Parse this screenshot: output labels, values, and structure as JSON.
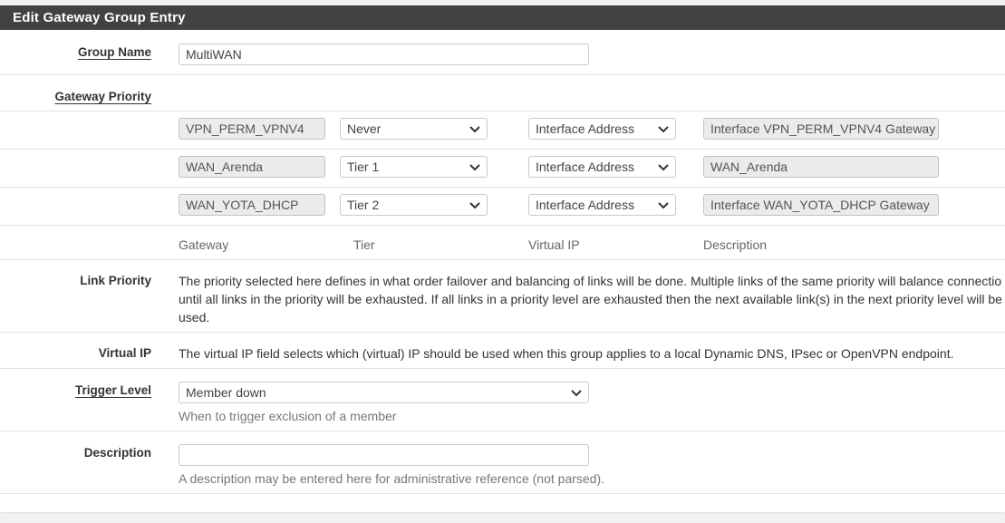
{
  "panel": {
    "title": "Edit Gateway Group Entry"
  },
  "group_name": {
    "label": "Group Name",
    "value": "MultiWAN"
  },
  "gateway_priority": {
    "label": "Gateway Priority",
    "rows": [
      {
        "gateway": "VPN_PERM_VPNV4",
        "tier": "Never",
        "virtual_ip": "Interface Address",
        "description": "Interface VPN_PERM_VPNV4 Gateway"
      },
      {
        "gateway": "WAN_Arenda",
        "tier": "Tier 1",
        "virtual_ip": "Interface Address",
        "description": "WAN_Arenda"
      },
      {
        "gateway": "WAN_YOTA_DHCP",
        "tier": "Tier 2",
        "virtual_ip": "Interface Address",
        "description": "Interface WAN_YOTA_DHCP Gateway"
      }
    ],
    "columns": {
      "gateway": "Gateway",
      "tier": "Tier",
      "virtual_ip": "Virtual IP",
      "description": "Description"
    }
  },
  "link_priority": {
    "label": "Link Priority",
    "lines": [
      "The priority selected here defines in what order failover and balancing of links will be done. Multiple links of the same priority will balance connectio",
      "until all links in the priority will be exhausted. If all links in a priority level are exhausted then the next available link(s) in the next priority level will be",
      "used."
    ]
  },
  "virtual_ip": {
    "label": "Virtual IP",
    "text": "The virtual IP field selects which (virtual) IP should be used when this group applies to a local Dynamic DNS, IPsec or OpenVPN endpoint."
  },
  "trigger_level": {
    "label": "Trigger Level",
    "value": "Member down",
    "help": "When to trigger exclusion of a member"
  },
  "description": {
    "label": "Description",
    "value": "",
    "help": "A description may be entered here for administrative reference (not parsed)."
  },
  "icons": {
    "select": "chevron-down-icon"
  }
}
